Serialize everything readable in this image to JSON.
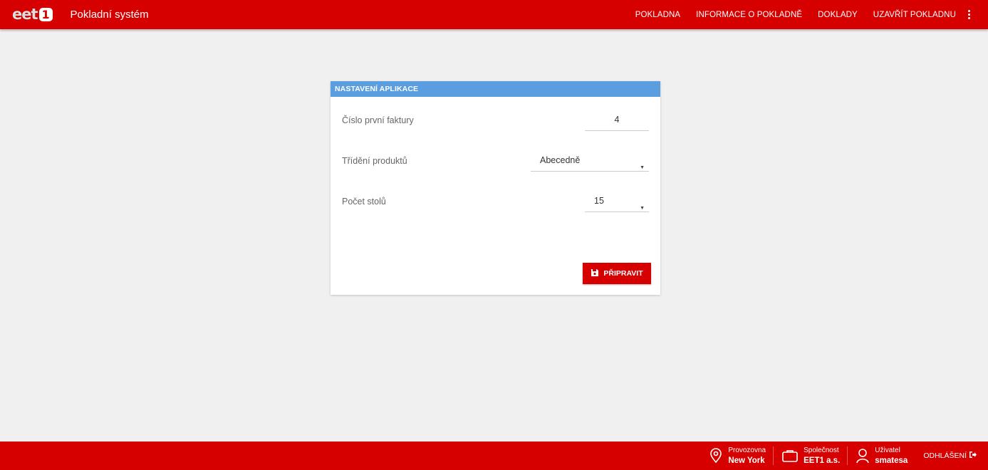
{
  "header": {
    "logo_text": "eet",
    "logo_number": "1",
    "app_title": "Pokladní systém",
    "nav": [
      "POKLADNA",
      "INFORMACE O POKLADNĚ",
      "DOKLADY",
      "UZAVŘÍT POKLADNU"
    ]
  },
  "card": {
    "title": "NASTAVENÍ APLIKACE",
    "first_invoice": {
      "label": "Číslo první faktury",
      "value": "4"
    },
    "product_sort": {
      "label": "Třídění produktů",
      "value": "Abecedně"
    },
    "table_count": {
      "label": "Počet stolů",
      "value": "15"
    },
    "button_label": "PŘIPRAVIT"
  },
  "footer": {
    "branch": {
      "label": "Provozovna",
      "value": "New York"
    },
    "company": {
      "label": "Společnost",
      "value": "EET1 a.s."
    },
    "user": {
      "label": "Uživatel",
      "value": "smatesa"
    },
    "logout_label": "ODHLÁŠENÍ"
  },
  "colors": {
    "brand_red": "#d70000",
    "card_header_blue": "#5a9ee0",
    "background": "#f0f0f0"
  },
  "icons": [
    "menu-dots-icon",
    "save-icon",
    "location-pin-icon",
    "briefcase-icon",
    "user-icon",
    "logout-icon"
  ]
}
